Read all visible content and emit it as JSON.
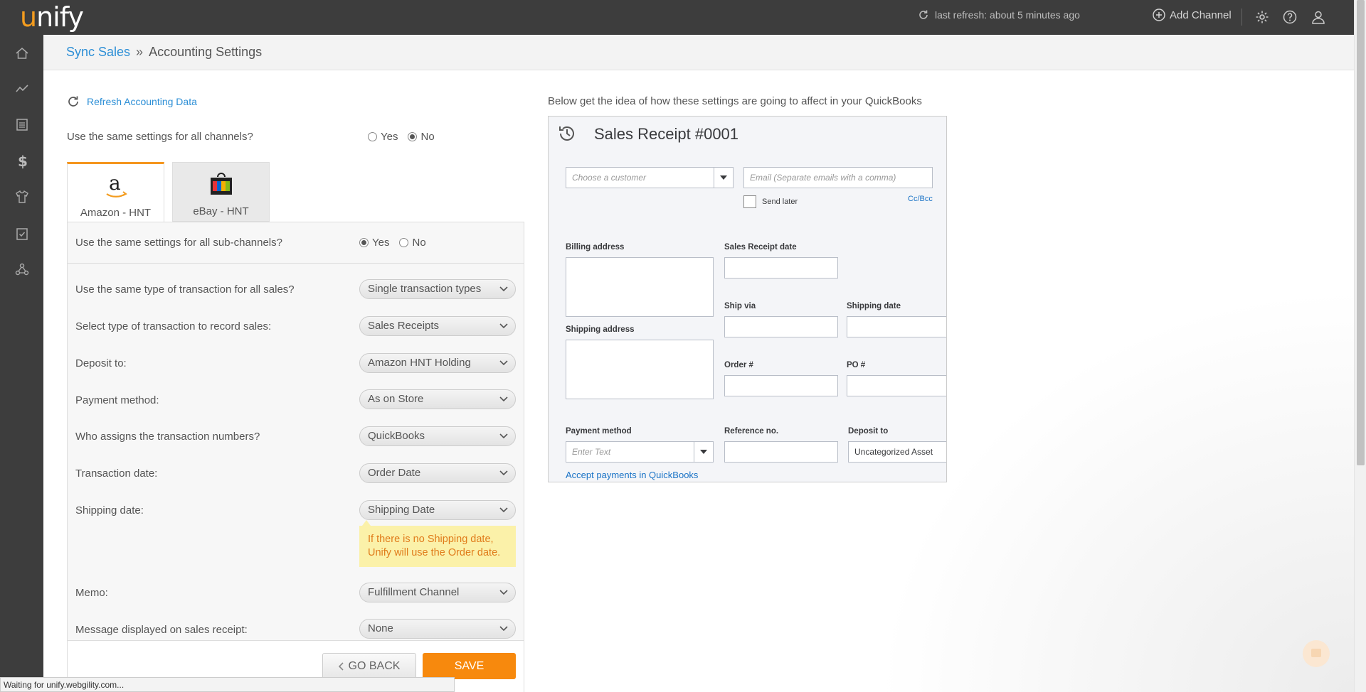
{
  "app": {
    "logo_text": "unify",
    "logo_first_letter": "u",
    "logo_rest": "nify"
  },
  "topbar": {
    "refresh_status": "last refresh: about 5 minutes ago",
    "add_channel": "Add Channel"
  },
  "breadcrumb": {
    "parent": "Sync Sales",
    "separator": "»",
    "current": "Accounting Settings"
  },
  "form": {
    "refresh_link": "Refresh Accounting Data",
    "same_settings_question": "Use the same settings for all channels?",
    "yes_label": "Yes",
    "no_label": "No",
    "same_settings_selected": "No",
    "tabs": [
      {
        "label": "Amazon - HNT",
        "active": true
      },
      {
        "label": "eBay - HNT",
        "active": false
      }
    ],
    "subchannels_question": "Use the same settings for all sub-channels?",
    "subchannels_selected": "Yes",
    "rows": [
      {
        "label": "Use the same type of transaction for all sales?",
        "value": "Single transaction types"
      },
      {
        "label": "Select type of transaction to record sales:",
        "value": "Sales Receipts"
      },
      {
        "label": "Deposit to:",
        "value": "Amazon HNT Holding"
      },
      {
        "label": "Payment method:",
        "value": "As on Store"
      },
      {
        "label": "Who assigns the transaction numbers?",
        "value": "QuickBooks"
      },
      {
        "label": "Transaction date:",
        "value": "Order Date"
      },
      {
        "label": "Shipping date:",
        "value": "Shipping Date"
      },
      {
        "label": "Memo:",
        "value": "Fulfillment Channel"
      },
      {
        "label": "Message displayed on sales receipt:",
        "value": "None"
      }
    ],
    "shipping_tooltip": "If there is no Shipping date, Unify will use the Order date.",
    "go_back": "GO BACK",
    "save": "SAVE"
  },
  "statusbar": {
    "text": "Waiting for unify.webgility.com..."
  },
  "preview": {
    "caption": "Below get the idea of how these settings are going to affect in your QuickBooks",
    "title": "Sales Receipt  #0001",
    "customer_placeholder": "Choose a customer",
    "email_placeholder": "Email (Separate emails with a comma)",
    "send_later": "Send later",
    "cc_bcc": "Cc/Bcc",
    "billing_address": "Billing address",
    "sales_receipt_date": "Sales Receipt date",
    "ship_via": "Ship via",
    "shipping_date": "Shipping date",
    "shipping_address": "Shipping address",
    "order_no": "Order #",
    "po_no": "PO #",
    "payment_method": "Payment method",
    "reference_no": "Reference no.",
    "deposit_to": "Deposit to",
    "payment_placeholder": "Enter Text",
    "deposit_value": "Uncategorized Asset",
    "accept_payments": "Accept payments in QuickBooks"
  },
  "colors": {
    "accent": "#f7890d",
    "link": "#2d8fd6",
    "topbar": "#3d3d3d"
  }
}
